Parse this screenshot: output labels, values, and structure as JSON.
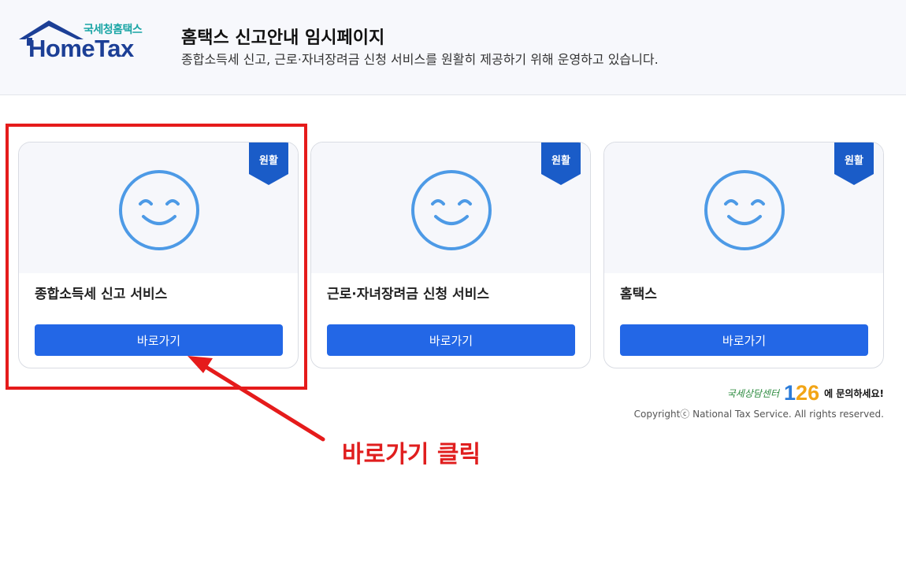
{
  "header": {
    "logo_kr": "국세청홈택스",
    "logo_en": "HomeTax",
    "title": "홈택스 신고안내 임시페이지",
    "description": "종합소득세 신고, 근로·자녀장려금 신청 서비스를 원활히 제공하기 위해 운영하고 있습니다."
  },
  "cards": [
    {
      "title": "종합소득세 신고 서비스",
      "status": "원활",
      "button": "바로가기"
    },
    {
      "title": "근로·자녀장려금 신청 서비스",
      "status": "원활",
      "button": "바로가기"
    },
    {
      "title": "홈택스",
      "status": "원활",
      "button": "바로가기"
    }
  ],
  "annotation": {
    "text": "바로가기 클릭"
  },
  "footer": {
    "consult_label": "국세상담센터",
    "consult_number": [
      "1",
      "2",
      "6"
    ],
    "consult_suffix": "에 문의하세요!",
    "copyright": "Copyrightⓒ National Tax Service. All rights reserved."
  },
  "colors": {
    "brand": "#1c3f96",
    "button": "#2367e6",
    "badge": "#1a5cc8",
    "smiley": "#4d9ae6",
    "annotation": "#e01e1e"
  }
}
